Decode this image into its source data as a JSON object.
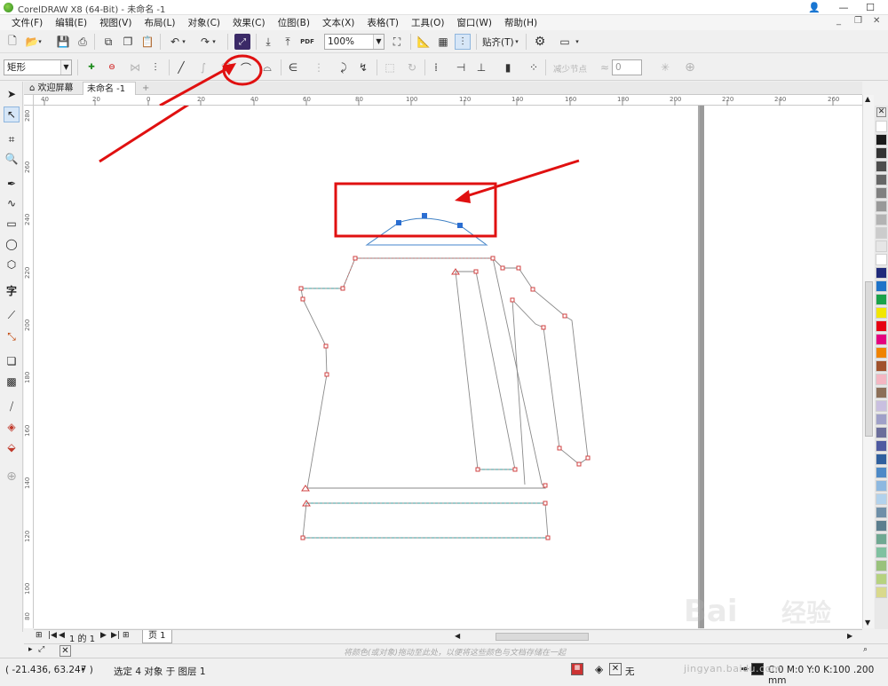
{
  "window": {
    "title": "CorelDRAW X8 (64-Bit) - 未命名 -1"
  },
  "menu": [
    "文件(F)",
    "编辑(E)",
    "视图(V)",
    "布局(L)",
    "对象(C)",
    "效果(C)",
    "位图(B)",
    "文本(X)",
    "表格(T)",
    "工具(O)",
    "窗口(W)",
    "帮助(H)"
  ],
  "toolbar": {
    "zoom": "100%",
    "snap_label": "贴齐(T)",
    "pdf_label": "PDF"
  },
  "propbar": {
    "object_type": "矩形",
    "reduce_nodes": "减少节点",
    "smoothness": "0"
  },
  "tabs": {
    "welcome": "欢迎屏幕",
    "document": "未命名 -1"
  },
  "ruler": {
    "h_ticks": [
      "40",
      "20",
      "0",
      "20",
      "40",
      "60",
      "80",
      "100",
      "120",
      "140",
      "160",
      "180",
      "200",
      "220",
      "240",
      "260"
    ],
    "v_ticks": [
      "280",
      "260",
      "240",
      "220",
      "200",
      "180",
      "160",
      "140",
      "120",
      "100",
      "80"
    ],
    "unit": "毫米"
  },
  "pagenav": {
    "of_label": "1 的 1",
    "page_tab": "页 1"
  },
  "colorbar": {
    "hint": "将颜色(或对象)拖动至此处，以便将这些颜色与文档存储在一起"
  },
  "status": {
    "coords": "( -21.436, 63.247 )",
    "selection": "选定 4 对象 于 图层 1",
    "fill_none": "无",
    "outline": "C:0 M:0 Y:0 K:100 .200 mm"
  },
  "watermark": {
    "brand": "Bai",
    "brand2": "经验",
    "url": "jingyan.baidu.com"
  },
  "palette_colors": [
    "#ffffff",
    "#1a1a1a",
    "#333333",
    "#4d4d4d",
    "#666666",
    "#808080",
    "#999999",
    "#b3b3b3",
    "#cccccc",
    "#e6e6e6",
    "#ffffff",
    "#1f2a7a",
    "#1e73c8",
    "#1aa24a",
    "#f2e600",
    "#e60012",
    "#e4007f",
    "#f08300",
    "#a0522d",
    "#f4b6c2",
    "#8c6f58",
    "#c9bfe0",
    "#9fa0c8",
    "#6b6e9b",
    "#4e5aa1",
    "#2f5f9e",
    "#4c89c7",
    "#8db8e0",
    "#b2d2ec",
    "#6e8fa8",
    "#5b7e8e",
    "#6fa892",
    "#7fc1a0",
    "#99c27c",
    "#b6d27f",
    "#d9d98c"
  ]
}
